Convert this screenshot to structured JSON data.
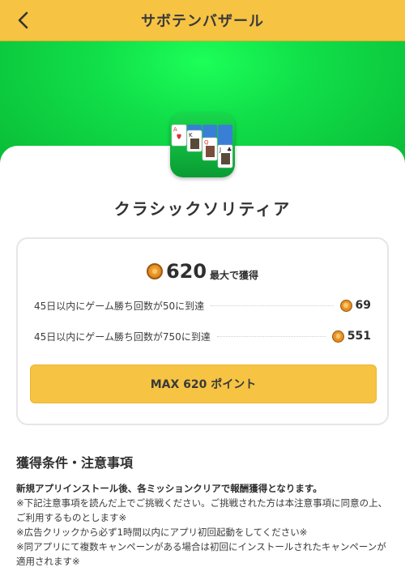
{
  "header": {
    "title": "サボテンバザール"
  },
  "app": {
    "name": "クラシックソリティア"
  },
  "reward": {
    "max_points": "620",
    "max_suffix": "最大で獲得",
    "missions": [
      {
        "label": "45日以内にゲーム勝ち回数が50に到達",
        "points": "69"
      },
      {
        "label": "45日以内にゲーム勝ち回数が750に到達",
        "points": "551"
      }
    ],
    "cta_label": "MAX 620 ポイント"
  },
  "conditions": {
    "title": "獲得条件・注意事項",
    "lead": "新規アプリインストール後、各ミッションクリアで報酬獲得となります。",
    "notes": [
      "※下記注意事項を読んだ上でご挑戦ください。ご挑戦された方は本注意事項に同意の上、ご利用するものとします※",
      "※広告クリックから必ず1時間以内にアプリ初回起動をしてください※",
      "※同アプリにて複数キャンペーンがある場合は初回にインストールされたキャンペーンが適用されます※"
    ]
  },
  "icons": {
    "back": "chevron-left-icon",
    "coin": "coin-icon",
    "app": "solitaire-app-icon"
  },
  "colors": {
    "accent": "#f6c343",
    "hero_green": "#11e04a"
  }
}
